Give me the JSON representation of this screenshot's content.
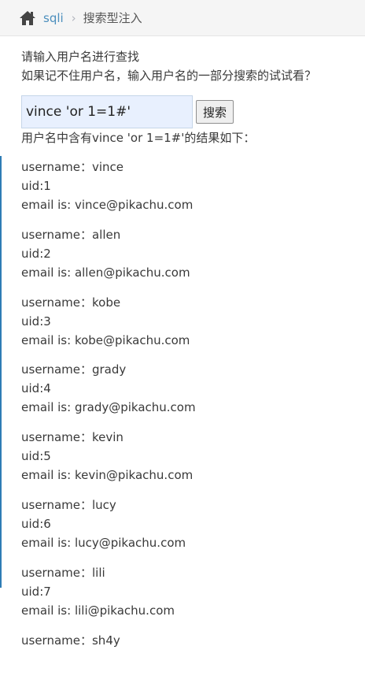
{
  "breadcrumb": {
    "home_icon": "home-icon",
    "section": "sqli",
    "separator": "›",
    "current": "搜索型注入"
  },
  "prompt": {
    "line1": "请输入用户名进行查找",
    "line2": "如果记不住用户名，输入用户名的一部分搜索的试试看？"
  },
  "search": {
    "value": "vince 'or 1=1#'",
    "button_label": "搜索"
  },
  "result_summary": "用户名中含有vince 'or 1=1#'的结果如下：",
  "results": [
    {
      "username": "username：vince",
      "uid": "uid:1",
      "email": "email is: vince@pikachu.com"
    },
    {
      "username": "username：allen",
      "uid": "uid:2",
      "email": "email is: allen@pikachu.com"
    },
    {
      "username": "username：kobe",
      "uid": "uid:3",
      "email": "email is: kobe@pikachu.com"
    },
    {
      "username": "username：grady",
      "uid": "uid:4",
      "email": "email is: grady@pikachu.com"
    },
    {
      "username": "username：kevin",
      "uid": "uid:5",
      "email": "email is: kevin@pikachu.com"
    },
    {
      "username": "username：lucy",
      "uid": "uid:6",
      "email": "email is: lucy@pikachu.com"
    },
    {
      "username": "username：lili",
      "uid": "uid:7",
      "email": "email is: lili@pikachu.com"
    },
    {
      "username": "username：sh4y",
      "uid": "",
      "email": ""
    }
  ],
  "colors": {
    "link": "#4c8fbd",
    "accent_rule": "#2e7cb5",
    "input_fill": "#e8f0fe",
    "text": "#393939"
  }
}
